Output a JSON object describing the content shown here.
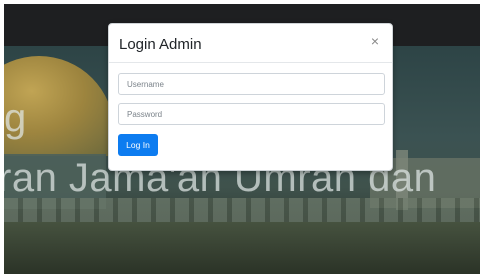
{
  "modal": {
    "title": "Login Admin",
    "close_glyph": "×",
    "username_placeholder": "Username",
    "password_placeholder": "Password",
    "login_label": "Log In"
  },
  "hero": {
    "line1": "g",
    "line2": "ran Jama'ah Umrah dan"
  },
  "colors": {
    "primary_button": "#0d7cf0",
    "topbar": "#1e1f21"
  }
}
